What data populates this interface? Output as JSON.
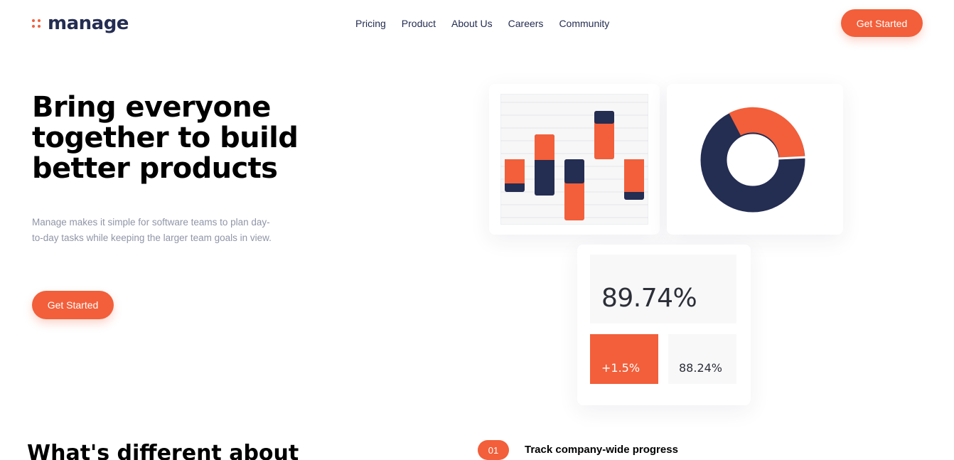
{
  "brand": {
    "name": "manage",
    "accent": "#f25f3a",
    "navy": "#242d52"
  },
  "nav": {
    "items": [
      "Pricing",
      "Product",
      "About Us",
      "Careers",
      "Community"
    ]
  },
  "header": {
    "cta_label": "Get Started"
  },
  "hero": {
    "title": "Bring everyone together to build better products",
    "description": "Manage makes it simple for software teams to plan day-to-day tasks while keeping the larger team goals in view.",
    "cta_label": "Get Started"
  },
  "illustration": {
    "donut": {
      "orange_share": 0.27
    },
    "stats": {
      "main": "89.74%",
      "change": "+1.5%",
      "secondary": "88.24%"
    }
  },
  "features_section": {
    "title": "What's different about",
    "features": [
      {
        "number": "01",
        "title": "Track company-wide progress"
      }
    ]
  }
}
